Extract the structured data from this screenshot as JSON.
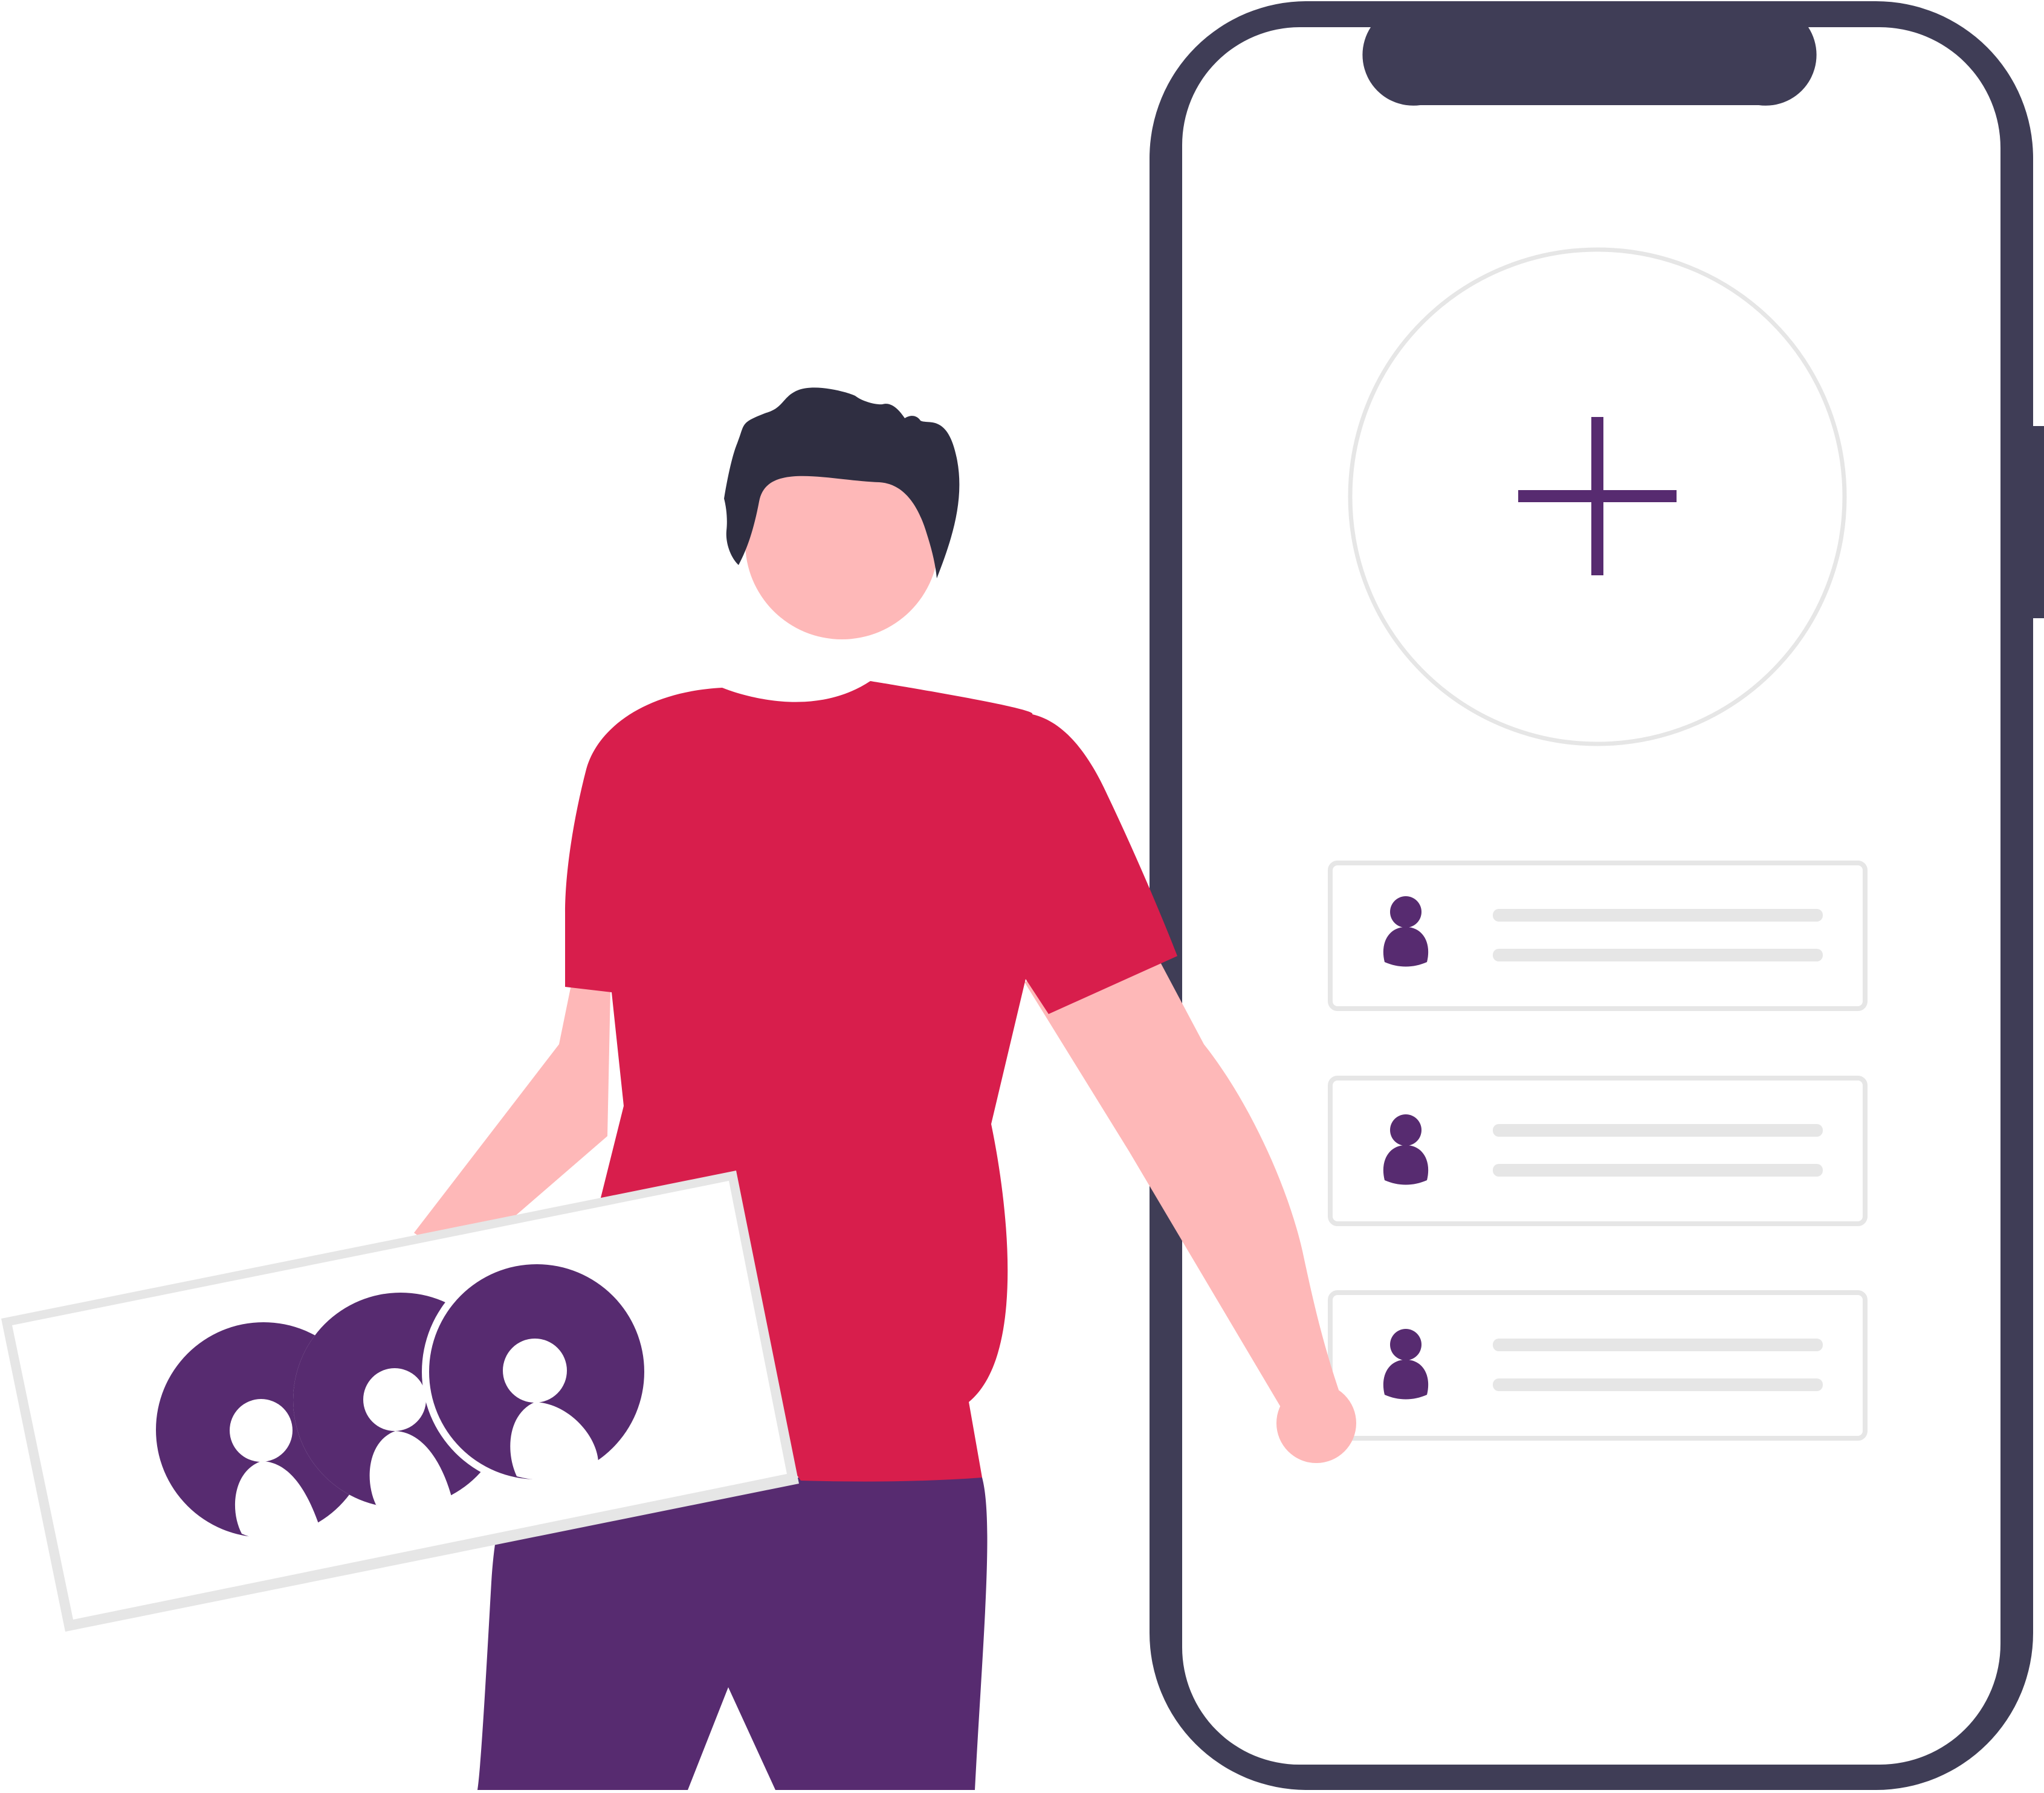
{
  "colors": {
    "background": "#ffffff",
    "phone_frame": "#3f3d56",
    "screen": "#ffffff",
    "accent_purple": "#572b70",
    "shirt_red": "#d81e4c",
    "skin": "#feb8b8",
    "hair": "#2f2e41",
    "outline_gray": "#e6e6e6",
    "placeholder_bar": "#e6e6e6"
  },
  "phone": {
    "add_button_icon": "plus-icon",
    "contacts": [
      {
        "avatar_icon": "person-icon"
      },
      {
        "avatar_icon": "person-icon"
      },
      {
        "avatar_icon": "person-icon"
      }
    ]
  },
  "card": {
    "avatars": [
      "person-icon",
      "person-icon",
      "person-icon"
    ]
  }
}
